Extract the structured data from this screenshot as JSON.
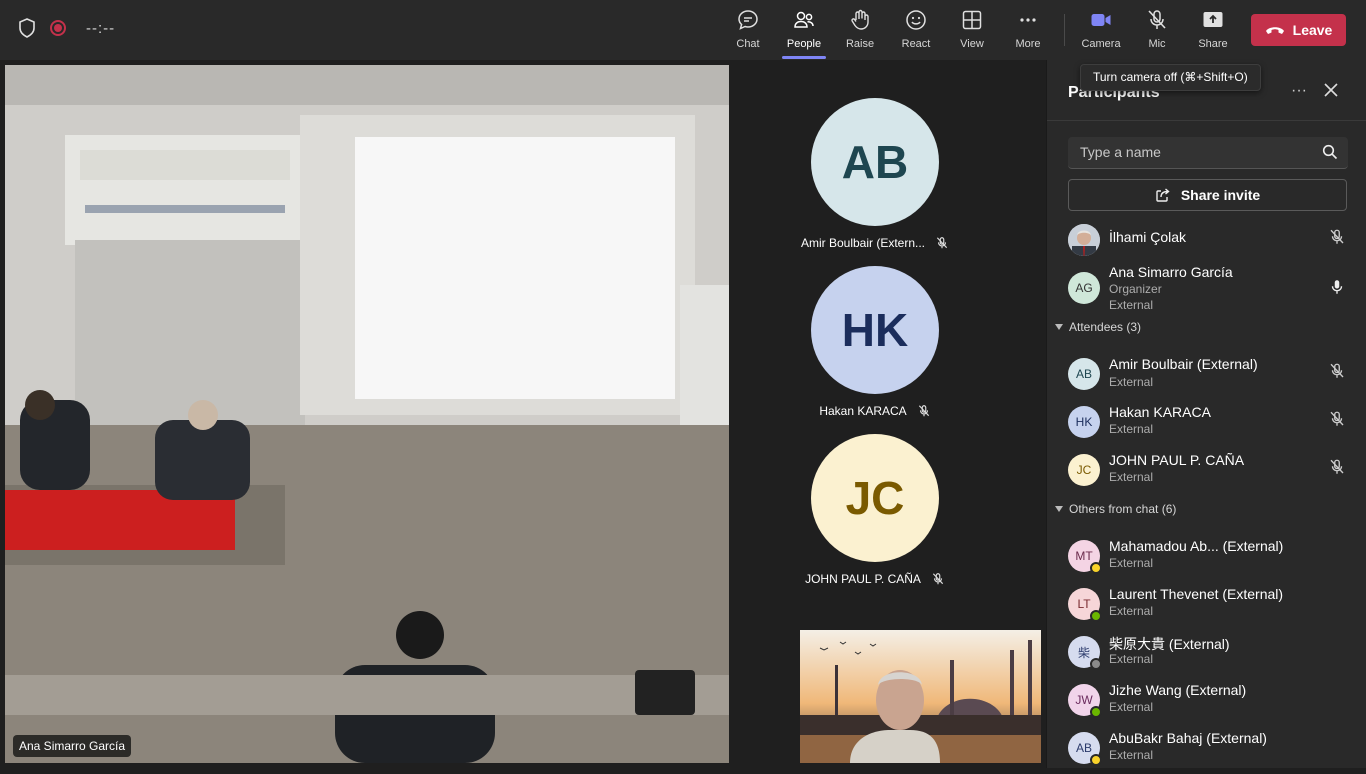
{
  "topbar": {
    "timer": "--:--",
    "buttons": {
      "chat": "Chat",
      "people": "People",
      "raise": "Raise",
      "react": "React",
      "view": "View",
      "more": "More",
      "camera": "Camera",
      "mic": "Mic",
      "share": "Share"
    },
    "leave": "Leave",
    "tooltip": "Turn camera off (⌘+Shift+O)"
  },
  "stage": {
    "main_video_name": "Ana Simarro García",
    "tiles": [
      {
        "initials": "AB",
        "name": "Amir Boulbair (Extern...",
        "bg": "#d6e6ea",
        "fg": "#1e4650"
      },
      {
        "initials": "HK",
        "name": "Hakan KARACA",
        "bg": "#c6d2ee",
        "fg": "#1b2d5c"
      },
      {
        "initials": "JC",
        "name": "JOHN PAUL P. CAÑA",
        "bg": "#fbf1d0",
        "fg": "#7a5a00"
      }
    ]
  },
  "panel": {
    "title": "Participants",
    "more": "···",
    "search_placeholder": "Type a name",
    "share_invite": "Share invite",
    "top": [
      {
        "name": "İlhami Çolak",
        "sub1": "",
        "sub2": ""
      },
      {
        "initials": "AG",
        "name": "Ana Simarro García",
        "sub1": "Organizer",
        "sub2": "External"
      }
    ],
    "attendees_header": "Attendees (3)",
    "attendees": [
      {
        "initials": "AB",
        "name": "Amir Boulbair (External)",
        "sub": "External"
      },
      {
        "initials": "HK",
        "name": "Hakan KARACA",
        "sub": "External"
      },
      {
        "initials": "JC",
        "name": "JOHN PAUL P. CAÑA",
        "sub": "External"
      }
    ],
    "others_header": "Others from chat (6)",
    "others": [
      {
        "initials": "MT",
        "name": "Mahamadou Ab...  (External)",
        "sub": "External",
        "status": "#f8d22a",
        "bg": "#f4d4e4"
      },
      {
        "initials": "LT",
        "name": "Laurent Thevenet (External)",
        "sub": "External",
        "status": "#6bb700",
        "bg": "#f6d6d8"
      },
      {
        "initials": "柴",
        "name": "柴原大貴 (External)",
        "sub": "External",
        "status": "#8a8a8a",
        "bg": "#d6dcef"
      },
      {
        "initials": "JW",
        "name": "Jizhe Wang (External)",
        "sub": "External",
        "status": "#6bb700",
        "bg": "#f1d4ea"
      },
      {
        "initials": "AB",
        "name": "AbuBakr Bahaj (External)",
        "sub": "External",
        "status": "#f8d22a",
        "bg": "#d6dcef"
      }
    ]
  }
}
